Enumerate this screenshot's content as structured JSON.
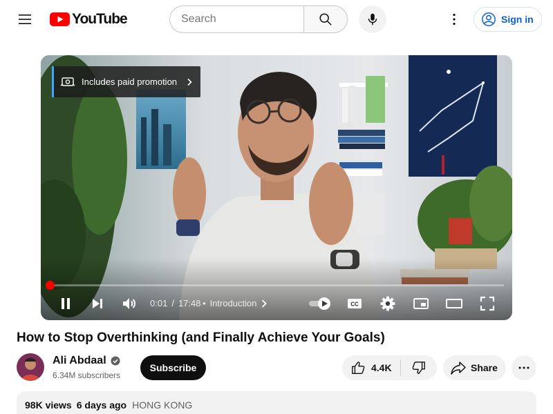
{
  "masthead": {
    "logo_text": "YouTube",
    "search_placeholder": "Search",
    "signin_label": "Sign in",
    "logo_color": "#ff0000",
    "signin_color": "#065fd4"
  },
  "player": {
    "promo_label": "Includes paid promotion",
    "time_current": "0:01",
    "time_separator": "/",
    "time_total": "17:48",
    "chapter": "Introduction",
    "progress_fraction": 0.001,
    "progress_color": "#ff0000",
    "cc_label": "CC"
  },
  "video": {
    "title": "How to Stop Overthinking (and Finally Achieve Your Goals)"
  },
  "channel": {
    "name": "Ali Abdaal",
    "subscribers": "6.34M subscribers",
    "subscribe_label": "Subscribe"
  },
  "actions": {
    "likes": "4.4K",
    "share_label": "Share"
  },
  "description": {
    "views": "98K views",
    "age": "6 days ago",
    "location": "HONG KONG"
  },
  "icons": [
    "hamburger-menu-icon",
    "youtube-logo-icon",
    "search-icon",
    "microphone-icon",
    "more-vert-icon",
    "account-circle-icon",
    "paid-promotion-icon",
    "chevron-right-icon",
    "pause-icon",
    "next-icon",
    "volume-icon",
    "autoplay-toggle-icon",
    "subtitles-icon",
    "settings-gear-icon",
    "miniplayer-icon",
    "theater-mode-icon",
    "fullscreen-icon",
    "verified-badge-icon",
    "thumbs-up-icon",
    "thumbs-down-icon",
    "share-arrow-icon",
    "more-horiz-icon"
  ]
}
